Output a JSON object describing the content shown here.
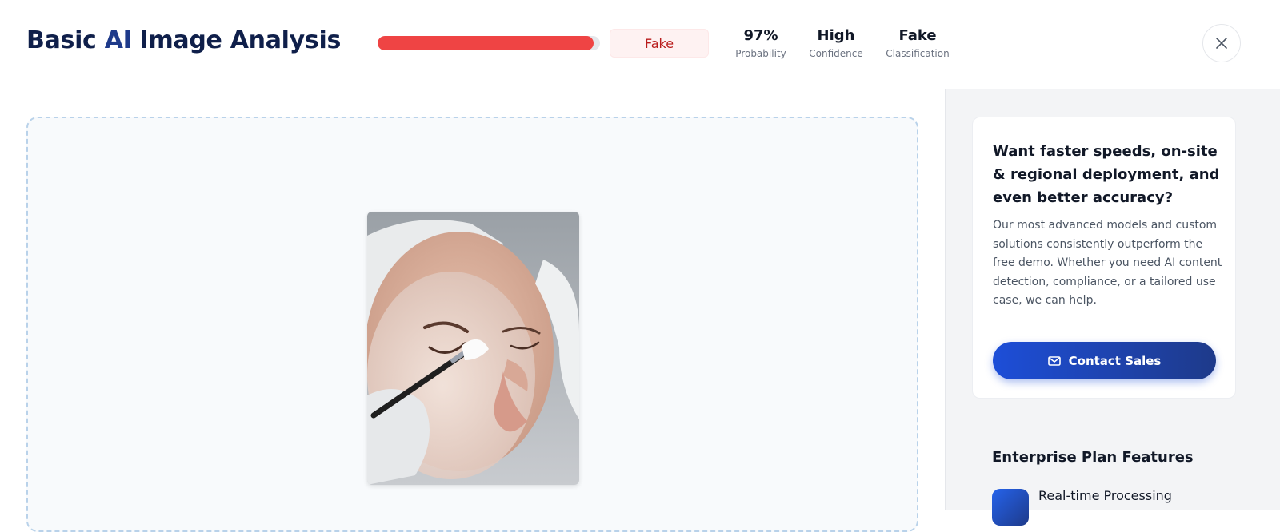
{
  "header": {
    "title_prefix": "Basic ",
    "title_ai": "AI",
    "title_suffix": " Image Analysis",
    "probability_fill": 0.97,
    "verdict_badge": "Fake",
    "stats": [
      {
        "value": "97%",
        "label": "Probability"
      },
      {
        "value": "High",
        "label": "Confidence"
      },
      {
        "value": "Fake",
        "label": "Classification"
      }
    ],
    "close_icon": "close-icon"
  },
  "colors": {
    "fake_red": "#ef4444",
    "brand_blue": "#1d4ed8",
    "navy": "#0f1f4a"
  },
  "sidebar": {
    "promo": {
      "heading": "Want faster speeds, on-site & regional deployment, and even better accuracy?",
      "body": "Our most advanced models and custom solutions consistently outperform the free demo. Whether you need AI content detection, compliance, or a tailored use case, we can help.",
      "button_label": "Contact Sales",
      "button_icon": "mail-icon"
    },
    "features_title": "Enterprise Plan Features",
    "features": [
      {
        "label": "Real-time Processing"
      }
    ]
  }
}
